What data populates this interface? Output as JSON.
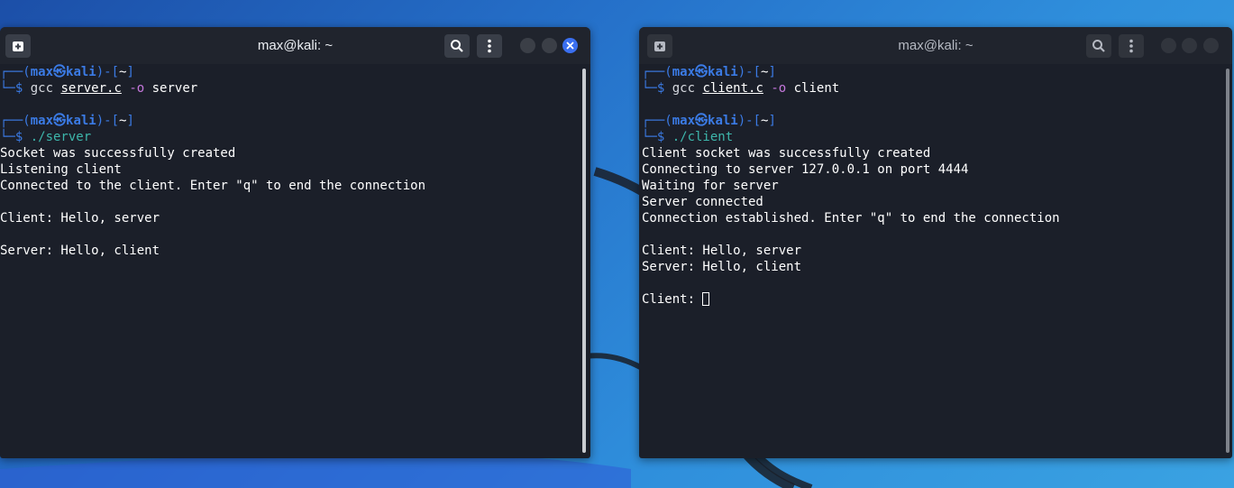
{
  "windows": [
    {
      "title": "max@kali: ~",
      "lines": [
        {
          "type": "prompt1",
          "user": "max",
          "host": "kali",
          "dir": "~"
        },
        {
          "type": "prompt2",
          "cmd": "gcc",
          "file": "server.c",
          "opt": "-o",
          "arg": "server"
        },
        {
          "type": "blank"
        },
        {
          "type": "prompt1",
          "user": "max",
          "host": "kali",
          "dir": "~"
        },
        {
          "type": "prompt2",
          "cmd": "./server"
        },
        {
          "type": "out",
          "text": "Socket was successfully created"
        },
        {
          "type": "out",
          "text": "Listening client"
        },
        {
          "type": "out",
          "text": "Connected to the client. Enter \"q\" to end the connection"
        },
        {
          "type": "blank"
        },
        {
          "type": "out",
          "text": "Client: Hello, server"
        },
        {
          "type": "blank"
        },
        {
          "type": "out",
          "text": "Server: Hello, client"
        }
      ]
    },
    {
      "title": "max@kali: ~",
      "lines": [
        {
          "type": "prompt1",
          "user": "max",
          "host": "kali",
          "dir": "~"
        },
        {
          "type": "prompt2",
          "cmd": "gcc",
          "file": "client.c",
          "opt": "-o",
          "arg": "client"
        },
        {
          "type": "blank"
        },
        {
          "type": "prompt1",
          "user": "max",
          "host": "kali",
          "dir": "~"
        },
        {
          "type": "prompt2",
          "cmd": "./client"
        },
        {
          "type": "out",
          "text": "Client socket was successfully created"
        },
        {
          "type": "out",
          "text": "Connecting to server 127.0.0.1 on port 4444"
        },
        {
          "type": "out",
          "text": "Waiting for server"
        },
        {
          "type": "out",
          "text": "Server connected"
        },
        {
          "type": "out",
          "text": "Connection established. Enter \"q\" to end the connection"
        },
        {
          "type": "blank"
        },
        {
          "type": "out",
          "text": "Client: Hello, server"
        },
        {
          "type": "out",
          "text": "Server: Hello, client"
        },
        {
          "type": "blank"
        },
        {
          "type": "input",
          "text": "Client: "
        }
      ]
    }
  ],
  "glyphs": {
    "prompt_top_open": "┌──(",
    "prompt_at": "㉿",
    "prompt_top_mid": ")-[",
    "prompt_top_close": "]",
    "prompt_bottom": "└─$ ",
    "space": " "
  },
  "icons": {
    "new_tab": "new-tab-icon",
    "search": "search-icon",
    "menu": "kebab-menu-icon",
    "minimize": "minimize-icon",
    "maximize": "maximize-icon",
    "close": "close-icon"
  },
  "colors": {
    "prompt_blue": "#3b7be5",
    "command_teal": "#3db6ab",
    "option_purple": "#c678dd",
    "close_button_blue": "#3a6ff0",
    "terminal_bg": "#1b1f29"
  }
}
